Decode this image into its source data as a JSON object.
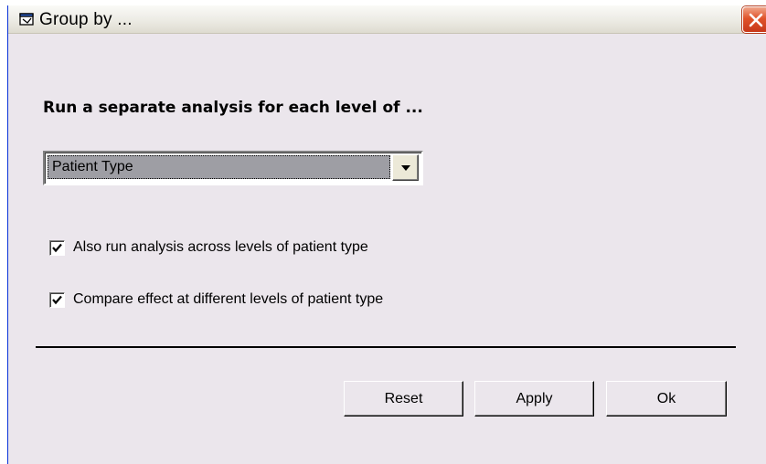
{
  "window": {
    "title": "Group by ...",
    "icon": "window-app-icon",
    "close_icon": "close-icon",
    "close_color": "#e0532a"
  },
  "heading": "Run a separate analysis for each level of ...",
  "group_select": {
    "selected": "Patient Type",
    "arrow_icon": "chevron-down-icon"
  },
  "options": [
    {
      "label": "Also run analysis across levels of patient type",
      "checked": true
    },
    {
      "label": "Compare effect at different levels of patient type",
      "checked": true
    }
  ],
  "buttons": {
    "reset": "Reset",
    "apply": "Apply",
    "ok": "Ok"
  }
}
